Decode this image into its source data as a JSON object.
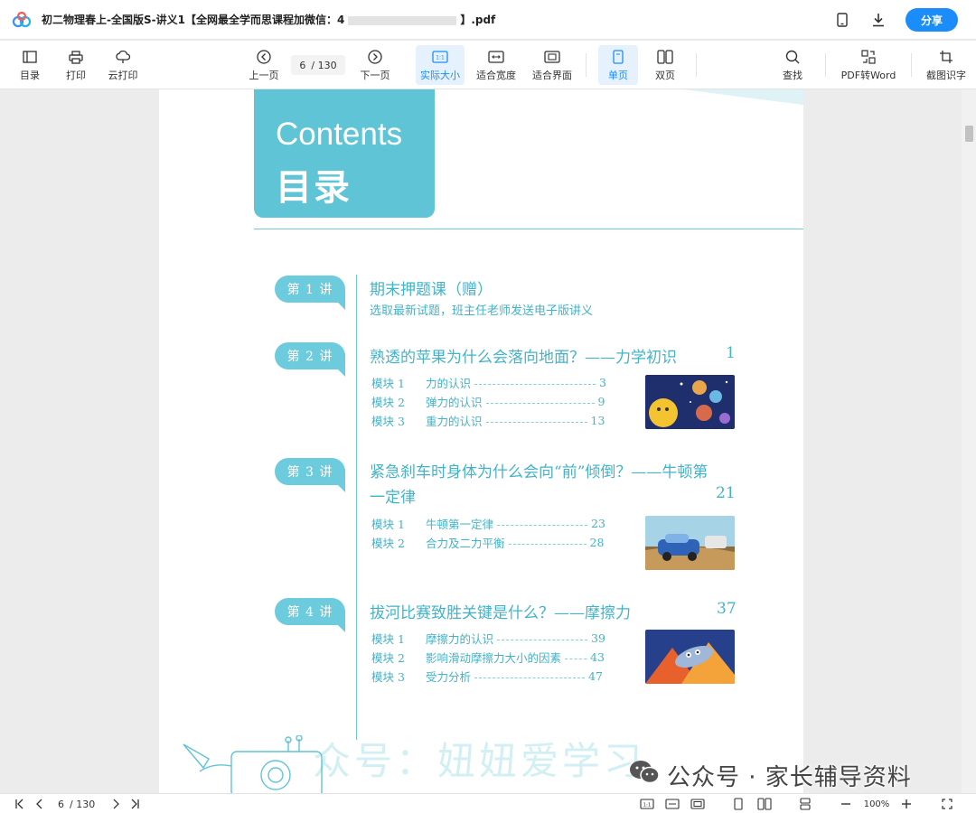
{
  "titlebar": {
    "document_title": "初二物理春上-全国版S-讲义1【全网最全学而思课程加微信：4",
    "document_title_suffix": "】.pdf",
    "share_label": "分享",
    "icons": [
      "app-logo-icon",
      "mobile-icon",
      "download-icon"
    ]
  },
  "toolbar": {
    "toc": "目录",
    "print": "打印",
    "cloud_print": "云打印",
    "prev_page": "上一页",
    "current_page": "6",
    "total_pages": "/ 130",
    "next_page": "下一页",
    "actual_size": "实际大小",
    "fit_width": "适合宽度",
    "fit_page": "适合界面",
    "single_page": "单页",
    "double_page": "双页",
    "find": "查找",
    "pdf_to_word": "PDF转Word",
    "screenshot_ocr": "截图识字"
  },
  "document": {
    "contents_en": "Contents",
    "contents_zh": "目录",
    "lectures": [
      {
        "tab": "第 1 讲",
        "title": "期末押题课（赠）",
        "subtitle": "选取最新试题，班主任老师发送电子版讲义",
        "page": "",
        "modules": []
      },
      {
        "tab": "第 2 讲",
        "title": "熟透的苹果为什么会落向地面？——力学初识",
        "page": "1",
        "modules": [
          {
            "no": "模块 1",
            "name": "力的认识",
            "page": "3"
          },
          {
            "no": "模块 2",
            "name": "弹力的认识",
            "page": "9"
          },
          {
            "no": "模块 3",
            "name": "重力的认识",
            "page": "13"
          }
        ]
      },
      {
        "tab": "第 3 讲",
        "title": "紧急刹车时身体为什么会向“前”倾倒？——牛顿第",
        "title_line2": "一定律",
        "page": "21",
        "modules": [
          {
            "no": "模块 1",
            "name": "牛顿第一定律",
            "page": "23"
          },
          {
            "no": "模块 2",
            "name": "合力及二力平衡",
            "page": "28"
          }
        ]
      },
      {
        "tab": "第 4 讲",
        "title": "拔河比赛致胜关键是什么？——摩擦力",
        "page": "37",
        "modules": [
          {
            "no": "模块 1",
            "name": "摩擦力的认识",
            "page": "39"
          },
          {
            "no": "模块 2",
            "name": "影响滑动摩擦力大小的因素",
            "page": "43"
          },
          {
            "no": "模块 3",
            "name": "受力分析",
            "page": "47"
          }
        ]
      }
    ],
    "watermark": "众号：妞妞爱学习"
  },
  "overlay_brand": "公众号 · 家长辅导资料",
  "bottombar": {
    "current_page": "6",
    "total_pages": "/ 130",
    "zoom": "100%"
  },
  "colors": {
    "accent": "#1b8dfa",
    "teal": "#5fc4d6",
    "teal_text": "#43b3c9"
  }
}
